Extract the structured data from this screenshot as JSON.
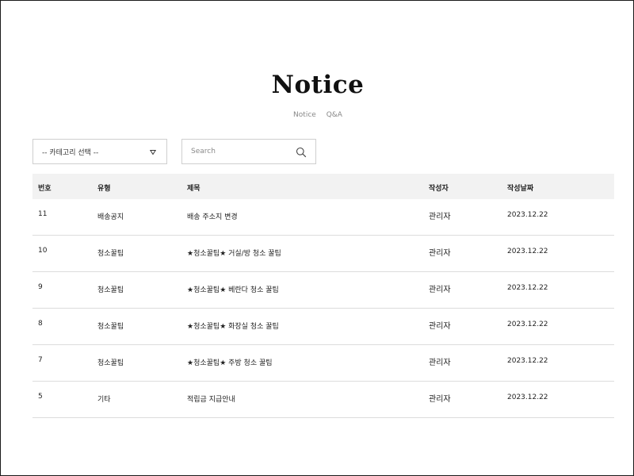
{
  "page": {
    "title": "Notice"
  },
  "subnav": [
    {
      "label": "Notice"
    },
    {
      "label": "Q&A"
    }
  ],
  "filters": {
    "category_label": "-- 카테고리 선택 --",
    "search_placeholder": "Search",
    "search_value": ""
  },
  "icons": {
    "category_caret": "chevron-down-icon",
    "search": "search-icon"
  },
  "table": {
    "headers": {
      "no": "번호",
      "type": "유형",
      "title": "제목",
      "author": "작성자",
      "date": "작성날짜"
    },
    "rows": [
      {
        "no": "11",
        "type": "배송공지",
        "title": "배송 주소지 변경",
        "author": "관리자",
        "date": "2023.12.22"
      },
      {
        "no": "10",
        "type": "청소꿀팁",
        "title": "★청소꿀팁★ 거실/방 청소 꿀팁",
        "author": "관리자",
        "date": "2023.12.22"
      },
      {
        "no": "9",
        "type": "청소꿀팁",
        "title": "★청소꿀팁★ 베란다 청소 꿀팁",
        "author": "관리자",
        "date": "2023.12.22"
      },
      {
        "no": "8",
        "type": "청소꿀팁",
        "title": "★청소꿀팁★ 화장실 청소 꿀팁",
        "author": "관리자",
        "date": "2023.12.22"
      },
      {
        "no": "7",
        "type": "청소꿀팁",
        "title": "★청소꿀팁★ 주방 청소 꿀팁",
        "author": "관리자",
        "date": "2023.12.22"
      },
      {
        "no": "5",
        "type": "기타",
        "title": "적립금 지급안내",
        "author": "관리자",
        "date": "2023.12.22"
      }
    ]
  }
}
